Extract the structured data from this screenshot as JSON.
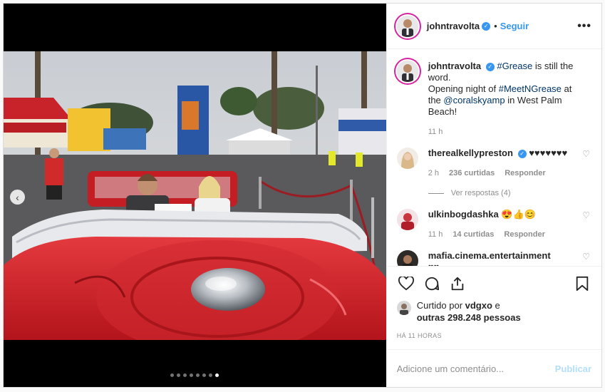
{
  "author": {
    "username": "johntravolta",
    "separator": "•",
    "follow_label": "Seguir",
    "more_label": "•••"
  },
  "caption": {
    "username": "johntravolta",
    "hashtag1": "#Grease",
    "text1": " is still the word.",
    "text2": "Opening night of ",
    "hashtag2": "#MeetNGrease",
    "text3": " at the ",
    "mention": "@coralskyamp",
    "text4": " in West Palm Beach!",
    "time": "11 h"
  },
  "comments": [
    {
      "username": "therealkellypreston",
      "text": "♥♥♥♥♥♥♥",
      "time": "2 h",
      "likes": "236 curtidas",
      "reply_label": "Responder",
      "view_replies": "Ver respostas (4)"
    },
    {
      "username": "ulkinbogdashka",
      "text": "😍👍😊",
      "time": "11 h",
      "likes": "14 curtidas",
      "reply_label": "Responder"
    },
    {
      "username": "mafia.cinema.entertainment",
      "text": "♥♥"
    }
  ],
  "likes": {
    "prefix": "Curtido por ",
    "first_user": "vdgxo",
    "middle": " e",
    "others": "outras 298.248 pessoas"
  },
  "timestamp": "HÁ 11 HORAS",
  "add_comment": {
    "placeholder": "Adicione um comentário...",
    "publish_label": "Publicar"
  },
  "carousel": {
    "count": 8,
    "active_index": 7
  },
  "colors": {
    "link": "#3897f0",
    "hashtag": "#003569",
    "car_red": "#d8232a"
  }
}
